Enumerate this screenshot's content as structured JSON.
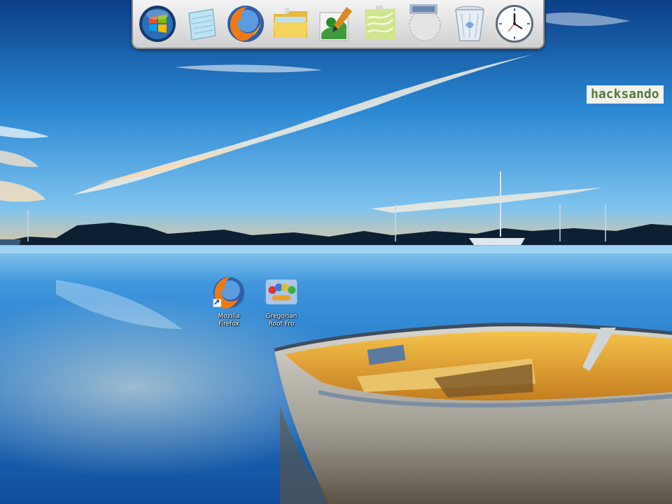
{
  "watermark": {
    "text": "hacksando"
  },
  "dock": {
    "items": [
      {
        "name": "Start",
        "icon": "windows-orb-icon"
      },
      {
        "name": "Notepad",
        "icon": "notepad-icon"
      },
      {
        "name": "Mozilla Firefox",
        "icon": "firefox-icon"
      },
      {
        "name": "Windows Explorer",
        "icon": "folder-icon"
      },
      {
        "name": "Paint",
        "icon": "paint-icon"
      },
      {
        "name": "Sticky Notes",
        "icon": "sticky-notes-icon"
      },
      {
        "name": "Gadget",
        "icon": "gadget-icon"
      },
      {
        "name": "Recycle Bin",
        "icon": "recycle-bin-icon"
      },
      {
        "name": "Clock",
        "icon": "clock-icon"
      }
    ]
  },
  "desktop_icons": [
    {
      "label": "Mozilla\nFirefox",
      "icon": "firefox-icon"
    },
    {
      "label": "Gregorian\nRoot Fro",
      "icon": "game-icon"
    }
  ],
  "colors": {
    "sky_top": "#0d3f8a",
    "sky_mid": "#2c86cf",
    "water": "#1f72c4",
    "boat_interior": "#e2a532",
    "dock_bg": "#e6e6e6"
  }
}
